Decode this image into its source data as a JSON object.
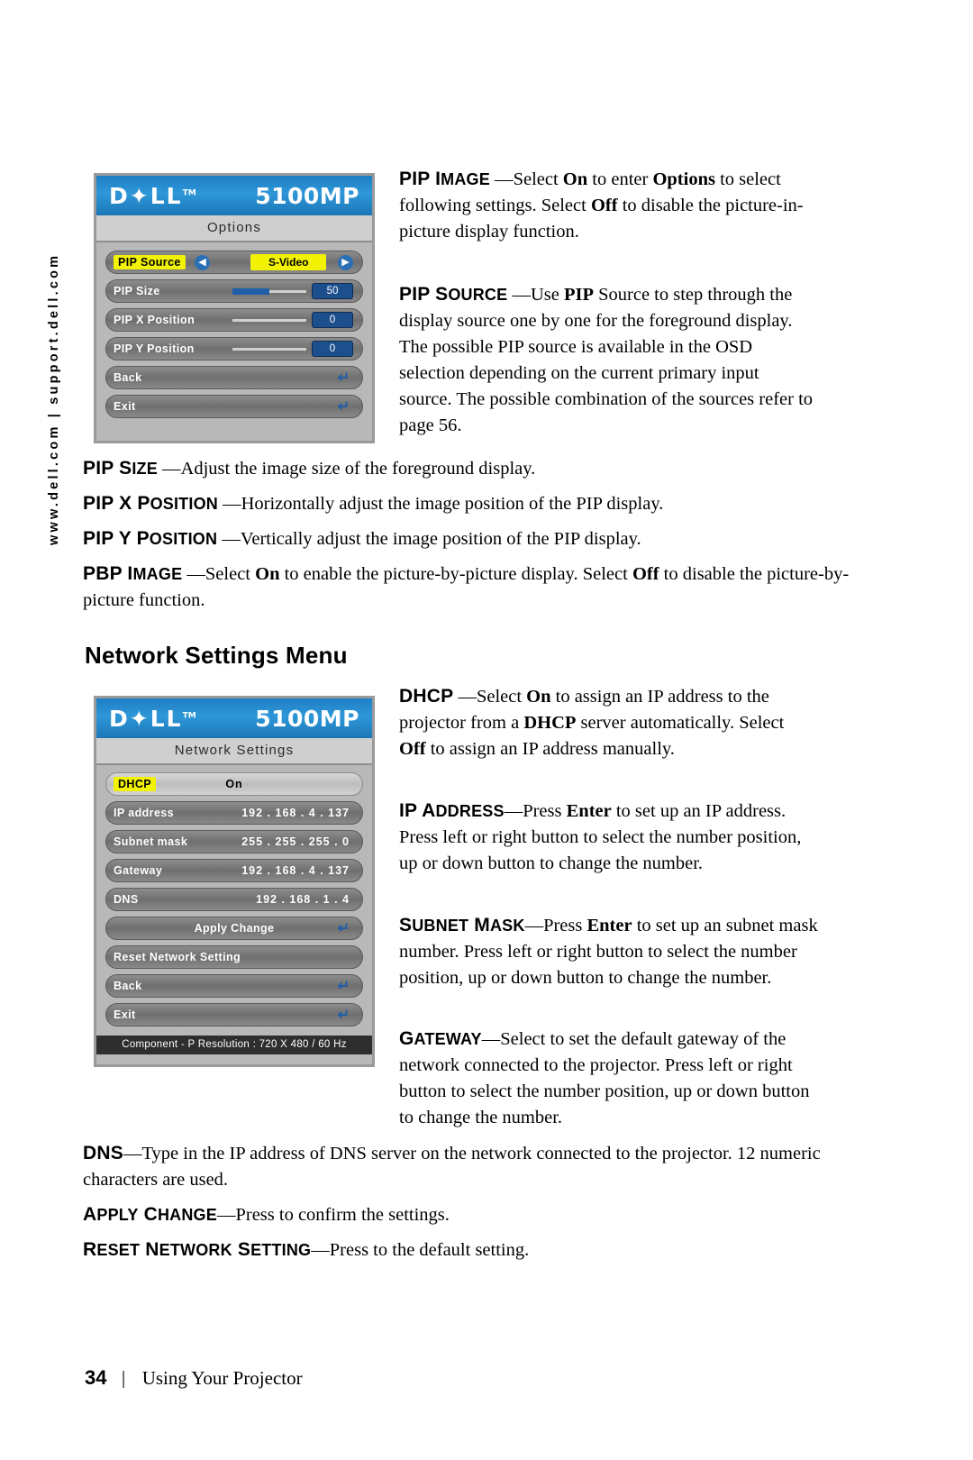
{
  "page": {
    "side_url": "www.dell.com | support.dell.com",
    "section_title": "Network Settings Menu",
    "footer_page": "34",
    "footer_sep": "|",
    "footer_title": "Using Your Projector"
  },
  "osd_options": {
    "brand": "D✦LL",
    "brand_tm": "TM",
    "model": "5100MP",
    "subtitle": "Options",
    "rows": [
      {
        "label": "PIP Source",
        "value": "S-Video",
        "type": "source"
      },
      {
        "label": "PIP Size",
        "value": "50",
        "type": "slider"
      },
      {
        "label": "PIP X Position",
        "value": "0",
        "type": "slider"
      },
      {
        "label": "PIP Y Position",
        "value": "0",
        "type": "slider"
      },
      {
        "label": "Back",
        "value": "",
        "type": "enter"
      },
      {
        "label": "Exit",
        "value": "",
        "type": "enter"
      }
    ]
  },
  "osd_network": {
    "brand": "D✦LL",
    "brand_tm": "TM",
    "model": "5100MP",
    "subtitle": "Network  Settings",
    "rows": [
      {
        "label": "DHCP",
        "value": "On",
        "type": "value",
        "selected": true
      },
      {
        "label": "IP address",
        "value": "192 . 168 .  4 .  137",
        "type": "value"
      },
      {
        "label": "Subnet mask",
        "value": "255 . 255 . 255 .  0",
        "type": "value"
      },
      {
        "label": "Gateway",
        "value": "192 . 168 .  4 .  137",
        "type": "value"
      },
      {
        "label": "DNS",
        "value": "192 . 168 .  1 .   4",
        "type": "value"
      },
      {
        "label": "Apply Change",
        "value": "",
        "type": "center-enter"
      },
      {
        "label": "Reset Network Setting",
        "value": "",
        "type": "plain"
      },
      {
        "label": "Back",
        "value": "",
        "type": "enter"
      },
      {
        "label": "Exit",
        "value": "",
        "type": "enter"
      }
    ],
    "status": "Component - P Resolution : 720 X 480 / 60 Hz"
  },
  "paragraphs": {
    "pip_image": {
      "term": "PIP I",
      "term_small": "MAGE",
      "dash": " —",
      "text1": "Select ",
      "b1": "On",
      "text2": " to enter ",
      "b2": "Options",
      "text3": " to select following settings. Select ",
      "b3": "Off",
      "text4": " to disable the picture-in-picture display function."
    },
    "pip_source": {
      "term": "PIP S",
      "term_small": "OURCE",
      "dash": " —",
      "text1": "Use ",
      "b1": "PIP",
      "text2": " Source to step through the display source one by one for the foreground display. The possible PIP source is available in the OSD selection depending on the current primary input source. The possible combination of the sources refer to page 56."
    },
    "pip_size": {
      "term": "PIP S",
      "term_small": "IZE",
      "dash": " —",
      "text1": "Adjust the image size of the foreground display."
    },
    "pip_x": {
      "term": "PIP X P",
      "term_small": "OSITION",
      "dash": " —",
      "text1": "Horizontally adjust the image position of the PIP display."
    },
    "pip_y": {
      "term": "PIP Y P",
      "term_small": "OSITION",
      "dash": " —",
      "text1": "Vertically adjust the image position of the PIP display."
    },
    "pbp_image": {
      "term": "PBP I",
      "term_small": "MAGE",
      "dash": " —",
      "text1": "Select ",
      "b1": "On",
      "text2": " to enable the picture-by-picture display. Select ",
      "b2": "Off",
      "text3": " to disable the picture-by-picture function."
    },
    "dhcp": {
      "term": "DHCP",
      "dash": " —",
      "text1": "Select ",
      "b1": "On",
      "text2": " to assign an IP address to the projector from a ",
      "b2": "DHCP",
      "text3": " server automatically. Select ",
      "b3": "Off",
      "text4": " to assign an IP address manually."
    },
    "ip_address": {
      "term": "IP A",
      "term_small": "DDRESS",
      "dash": "—",
      "text1": "Press ",
      "b1": "Enter",
      "text2": " to set up an IP address. Press left or right button to select the number position, up or down button to change the number."
    },
    "subnet_mask": {
      "term": "S",
      "term_small": "UBNET",
      "term2": " M",
      "term2_small": "ASK",
      "dash": "—",
      "text1": "Press ",
      "b1": "Enter",
      "text2": " to set up an subnet mask number. Press left or right button to select the number position, up or down button to change the number."
    },
    "gateway": {
      "term": "G",
      "term_small": "ATEWAY",
      "dash": "—",
      "text1": "Select to set the default gateway of the network connected to the projector. Press left or right button to select the number position, up or down button to change the number."
    },
    "dns": {
      "term": "DNS",
      "dash": "—",
      "text1": "Type in the IP address of DNS server on the network connected to the projector. 12 numeric characters are used."
    },
    "apply_change": {
      "term": "A",
      "term_small": "PPLY",
      "term2": " C",
      "term2_small": "HANGE",
      "dash": "—",
      "text1": "Press to confirm the settings."
    },
    "reset_network": {
      "term": "R",
      "term_small": "ESET",
      "term2": " N",
      "term2_small": "ETWORK",
      "term3": " S",
      "term3_small": "ETTING",
      "dash": "—",
      "text1": "Press to the default setting."
    }
  }
}
